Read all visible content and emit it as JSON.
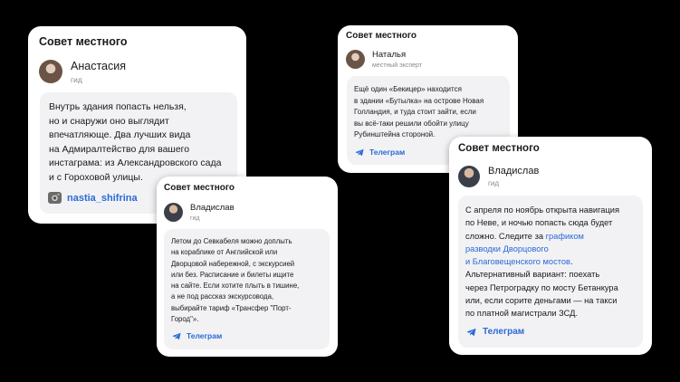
{
  "cards": {
    "anastasia": {
      "title": "Совет местного",
      "name": "Анастасия",
      "role": "гид",
      "lines": [
        "Внутрь здания попасть нельзя,",
        "но и снаружи оно выглядит",
        "впечатляюще. Два лучших вида",
        "на Адмиралтейство для вашего",
        "инстаграма: из Александровского сада",
        "и с Гороховой улицы."
      ],
      "link_label": "nastia_shifrina"
    },
    "natalya": {
      "title": "Совет местного",
      "name": "Наталья",
      "role": "местный эксперт",
      "lines": [
        "Ещё один «Бекицер» находится",
        "в здании «Бутылка» на острове Новая",
        "Голландия, и туда стоит зайти, если",
        "вы всё-таки решили обойти улицу",
        "Рубинштейна стороной."
      ],
      "link_label": "Телеграм"
    },
    "vladislav_small": {
      "title": "Совет местного",
      "name": "Владислав",
      "role": "гид",
      "lines": [
        "Летом до Севкабеля можно доплыть",
        "на кораблике от Английской или",
        "Дворцовой набережной, с экскурсией",
        "или без. Расписание и билеты ищите",
        "на сайте. Если хотите плыть в тишине,",
        "а не под рассказ экскурсовода,",
        "выбирайте тариф «Трансфер \"Порт-",
        "Город\"»."
      ],
      "link_label": "Телеграм"
    },
    "vladislav_large": {
      "title": "Совет местного",
      "name": "Владислав",
      "role": "гид",
      "line1": "С апреля по ноябрь открыта навигация",
      "line2": "по Неве, и ночью попасть сюда будет",
      "line3_pre": "сложно. Следите за ",
      "line3_link": "графиком",
      "line4_link": "разводки Дворцового",
      "line5_link": "и Благовещенского мостов",
      "line5_post": ".",
      "line6": "Альтернативный вариант: поехать",
      "line7": "через Петроградку по мосту Бетанкура",
      "line8": "или, если сорите деньгами — на такси",
      "line9": "по платной магистрали ЗСД.",
      "link_label": "Телеграм"
    }
  },
  "colors": {
    "background": "#000000",
    "card": "#ffffff",
    "bubble": "#f2f2f4",
    "link": "#2a6ad6",
    "muted": "#8a8a8a"
  },
  "icons": [
    "telegram-icon",
    "instagram-icon",
    "avatar"
  ]
}
